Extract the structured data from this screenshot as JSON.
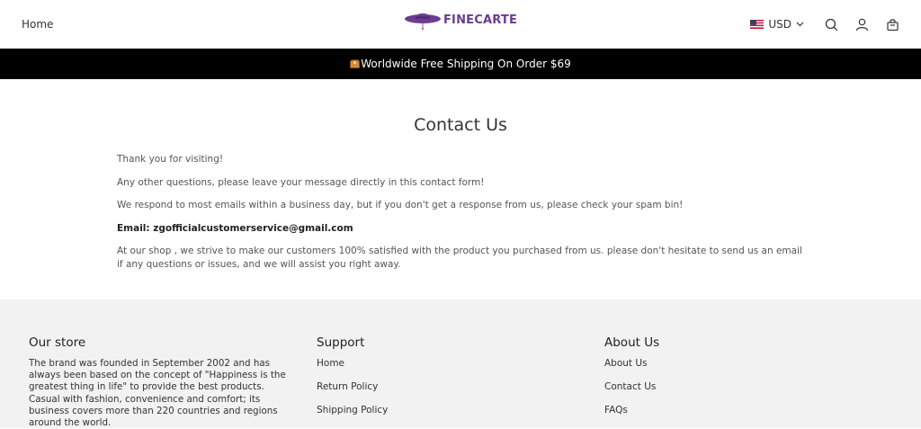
{
  "header": {
    "nav_home": "Home",
    "logo_text": "FINECARTE",
    "currency": "USD",
    "icons": [
      "chevron-down-icon",
      "search-icon",
      "user-icon",
      "cart-icon"
    ],
    "brand_color": "#6b3d8f"
  },
  "announcement": {
    "text": "Worldwide Free Shipping On Order $69"
  },
  "main": {
    "title": "Contact Us",
    "paragraphs": [
      "Thank you for visiting!",
      "Any other questions, please leave your message directly in this contact form!",
      "We respond to most emails within a business day, but if you don't get a response from us, please check your spam bin!",
      "Email: zgofficialcustomerservice@gmail.com",
      "At our shop , we strive to make our customers 100% satisfied with the product you purchased from us. please don't hesitate to send us an email if any questions or issues, and we will assist you right away."
    ]
  },
  "footer": {
    "our_store": {
      "heading": "Our store",
      "text": "The brand was founded in September 2002 and has always been based on the concept of \"Happiness is the greatest thing in life\" to provide the best products. Casual with fashion, convenience and comfort; its business covers more than 220 countries and regions around the world."
    },
    "support": {
      "heading": "Support",
      "links": [
        "Home",
        "Return Policy",
        "Shipping Policy"
      ]
    },
    "about": {
      "heading": "About Us",
      "links": [
        "About Us",
        "Contact Us",
        "FAQs"
      ]
    }
  }
}
